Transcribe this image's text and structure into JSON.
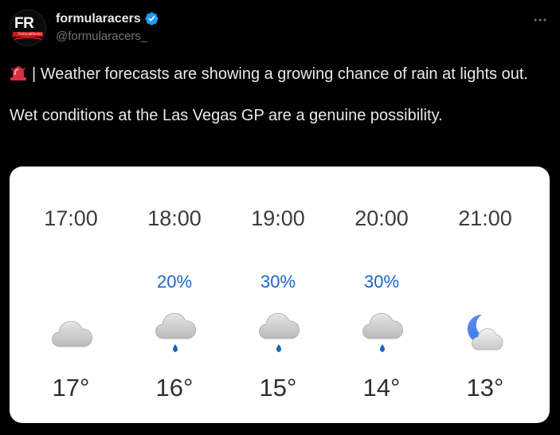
{
  "account": {
    "display_name": "formularacers",
    "handle": "@formularacers_",
    "avatar_text": "FR",
    "avatar_subtext": "FormulaRacers",
    "verified": true,
    "verified_color": "#1d9bf0"
  },
  "tweet": {
    "line1": "| Weather forecasts are showing a growing chance of rain at lights out.",
    "line2": "Wet conditions at the Las Vegas GP are a genuine possibility.",
    "lead_emoji": "siren-icon"
  },
  "forecast": {
    "hours": [
      {
        "time": "17:00",
        "chance": "",
        "icon": "cloud-icon",
        "temp": "17°"
      },
      {
        "time": "18:00",
        "chance": "20%",
        "icon": "cloud-rain-icon",
        "temp": "16°"
      },
      {
        "time": "19:00",
        "chance": "30%",
        "icon": "cloud-rain-icon",
        "temp": "15°"
      },
      {
        "time": "20:00",
        "chance": "30%",
        "icon": "cloud-rain-icon",
        "temp": "14°"
      },
      {
        "time": "21:00",
        "chance": "",
        "icon": "moon-cloud-icon",
        "temp": "13°"
      }
    ],
    "chance_color": "#1b64c8",
    "rain_drop_color": "#1565c0",
    "moon_color": "#2f6fe0"
  },
  "colors": {
    "background": "#000000",
    "text_primary": "#e7e9ea",
    "text_secondary": "#71767b",
    "card_background": "#ffffff"
  }
}
